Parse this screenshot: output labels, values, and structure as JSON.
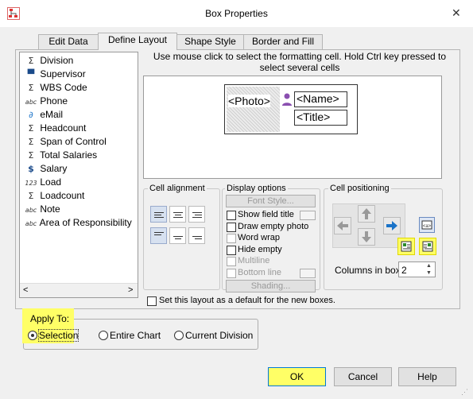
{
  "window": {
    "title": "Box Properties"
  },
  "tabs": [
    "Edit Data",
    "Define Layout",
    "Shape Style",
    "Border and Fill"
  ],
  "fields": [
    {
      "icon": "sum-icon",
      "glyph": "Σ",
      "label": "Division"
    },
    {
      "icon": "org-chart-icon",
      "glyph": "▀",
      "label": "Supervisor"
    },
    {
      "icon": "sum-icon",
      "glyph": "Σ",
      "label": "WBS Code"
    },
    {
      "icon": "text-field-icon",
      "glyph": "abc",
      "label": "Phone"
    },
    {
      "icon": "email-link-icon",
      "glyph": "∂",
      "label": "eMail"
    },
    {
      "icon": "sum-icon",
      "glyph": "Σ",
      "label": "Headcount"
    },
    {
      "icon": "sum-icon",
      "glyph": "Σ",
      "label": "Span of Control"
    },
    {
      "icon": "sum-icon",
      "glyph": "Σ",
      "label": "Total Salaries"
    },
    {
      "icon": "currency-icon",
      "glyph": "$",
      "label": "Salary"
    },
    {
      "icon": "number-field-icon",
      "glyph": "123",
      "label": "Load"
    },
    {
      "icon": "sum-icon",
      "glyph": "Σ",
      "label": "Loadcount"
    },
    {
      "icon": "text-field-icon",
      "glyph": "abc",
      "label": "Note"
    },
    {
      "icon": "text-field-icon",
      "glyph": "abc",
      "label": "Area of Responsibility"
    }
  ],
  "instruction": "Use mouse click to select the formatting cell. Hold Ctrl key pressed to select several cells",
  "layout_cells": {
    "photo": "<Photo>",
    "name": "<Name>",
    "title": "<Title>"
  },
  "cell_alignment": {
    "label": "Cell alignment"
  },
  "display_options": {
    "label": "Display options",
    "font_style": "Font Style...",
    "show_field_title": "Show field title",
    "draw_empty_photo": "Draw empty photo",
    "word_wrap": "Word wrap",
    "hide_empty": "Hide empty",
    "multiline": "Multiline",
    "bottom_line": "Bottom line",
    "shading": "Shading..."
  },
  "cell_positioning": {
    "label": "Cell positioning",
    "columns_label": "Columns in box:",
    "columns_value": "2"
  },
  "default_layout": "Set this layout as a default for the new boxes.",
  "apply_to": {
    "label": "Apply To:",
    "selection": "Selection",
    "entire_chart": "Entire Chart",
    "current_division": "Current Division",
    "selected": "Selection"
  },
  "buttons": {
    "ok": "OK",
    "cancel": "Cancel",
    "help": "Help"
  },
  "colors": {
    "highlight": "#ffff66",
    "accent_blue": "#1a73c8",
    "photo_purple": "#8a4fb0"
  }
}
